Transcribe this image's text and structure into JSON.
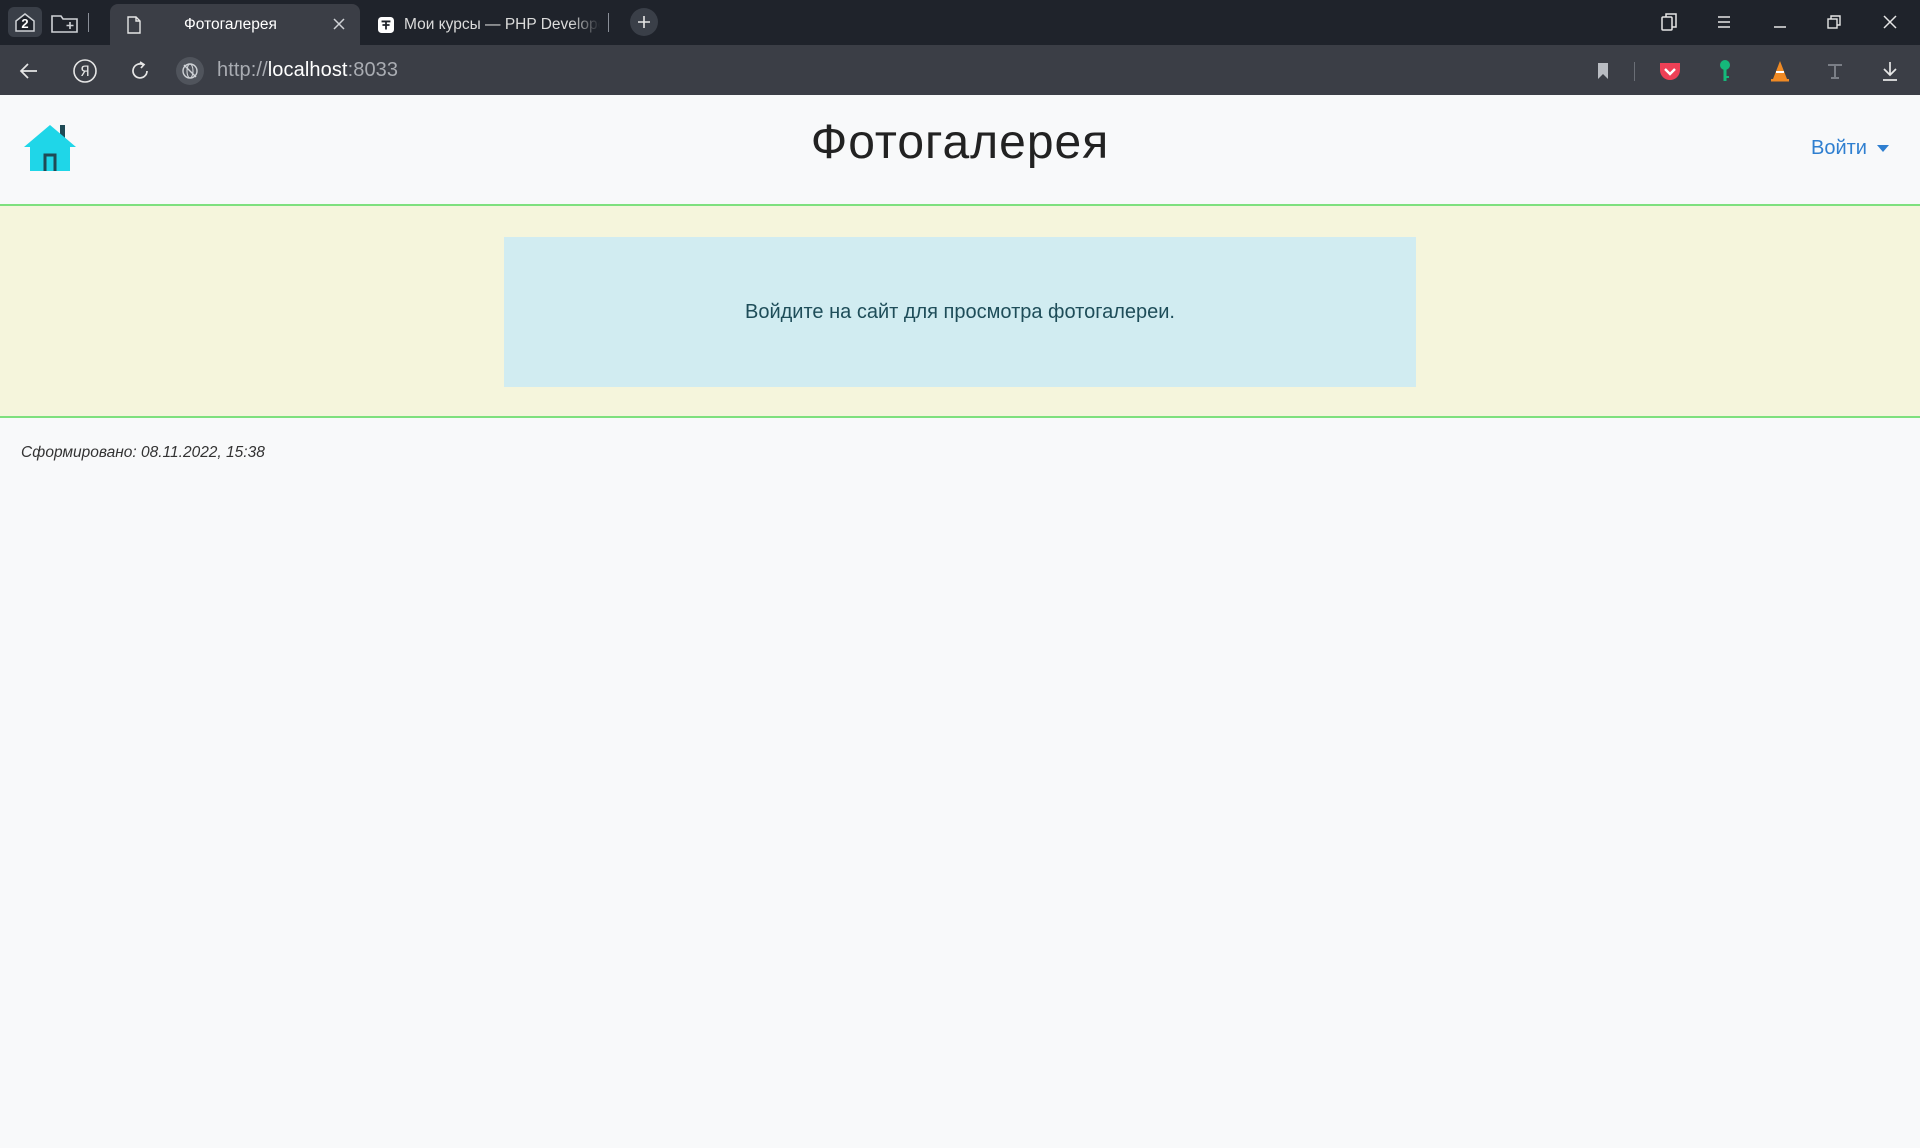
{
  "browser": {
    "tab_count": "2",
    "tabs": [
      {
        "title": "Фотогалерея",
        "active": true
      },
      {
        "title": "Мои курсы — PHP Developer",
        "active": false
      }
    ],
    "url": {
      "protocol": "http://",
      "host": "localhost",
      "port": ":8033"
    }
  },
  "header": {
    "logo_icon": "home-icon",
    "title": "Фотогалерея",
    "login_label": "Войти"
  },
  "main": {
    "alert_text": "Войдите на сайт для просмотра фотогалереи."
  },
  "footer": {
    "generated_text": "Сформировано: 08.11.2022, 15:38"
  },
  "colors": {
    "accent": "#2f7fd0",
    "border_green": "#7ee07e",
    "band_bg": "#f5f5dc",
    "alert_bg": "#d1ecf1",
    "logo_cyan": "#1fd6e8"
  }
}
